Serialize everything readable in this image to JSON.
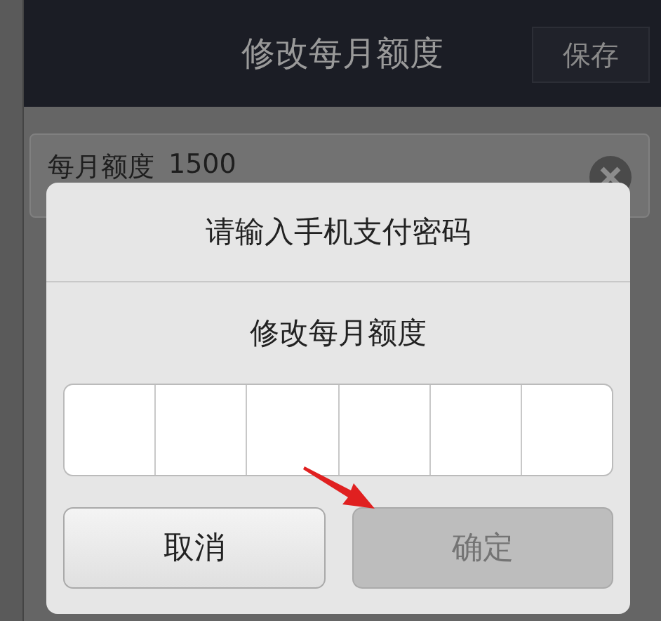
{
  "app_bar": {
    "title": "修改每月额度",
    "save_button": "保存"
  },
  "limit_field": {
    "label": "每月额度",
    "value": "1500"
  },
  "dialog": {
    "title": "请输入手机支付密码",
    "subtitle": "修改每月额度",
    "buttons": [
      {
        "label": "取消",
        "disabled": false
      },
      {
        "label": "确定",
        "disabled": true
      }
    ]
  }
}
